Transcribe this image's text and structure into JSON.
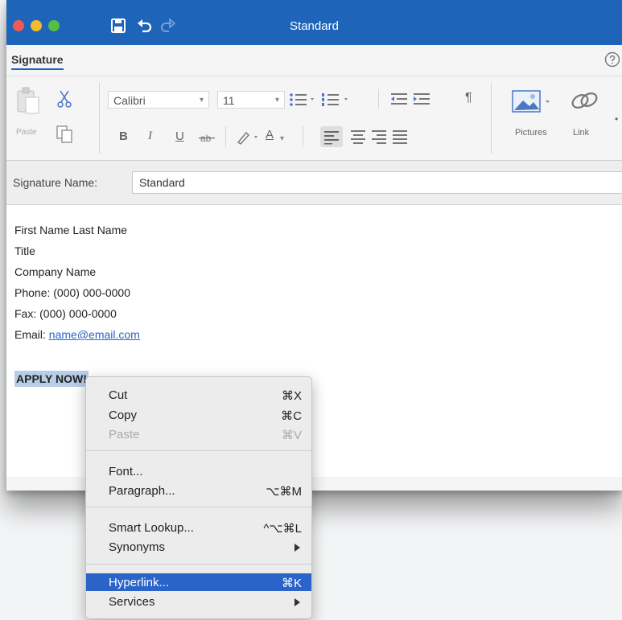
{
  "window": {
    "title": "Standard"
  },
  "tabs": {
    "signature": "Signature"
  },
  "ribbon": {
    "paste_label": "Paste",
    "font_name": "Calibri",
    "font_size": "11",
    "bold": "B",
    "italic": "I",
    "underline": "U",
    "font_color_letter": "A",
    "pilcrow": "¶",
    "pictures_label": "Pictures",
    "link_label": "Link"
  },
  "signature_name": {
    "label": "Signature Name:",
    "value": "Standard"
  },
  "signature_body": {
    "lines": [
      "First Name Last Name",
      "Title",
      "Company Name",
      "Phone: (000) 000-0000",
      "Fax: (000) 000-0000"
    ],
    "email_prefix": "Email: ",
    "email_link": "name@email.com",
    "apply_text": "APPLY NOW!"
  },
  "context_menu": {
    "cut": {
      "label": "Cut",
      "shortcut": "⌘X"
    },
    "copy": {
      "label": "Copy",
      "shortcut": "⌘C"
    },
    "paste": {
      "label": "Paste",
      "shortcut": "⌘V"
    },
    "font": {
      "label": "Font..."
    },
    "paragraph": {
      "label": "Paragraph...",
      "shortcut": "⌥⌘M"
    },
    "smart_lookup": {
      "label": "Smart Lookup...",
      "shortcut": "^⌥⌘L"
    },
    "synonyms": {
      "label": "Synonyms"
    },
    "hyperlink": {
      "label": "Hyperlink...",
      "shortcut": "⌘K"
    },
    "services": {
      "label": "Services"
    }
  },
  "colors": {
    "title_bar": "#1e65b9",
    "highlight": "#2b64c9",
    "link": "#2a62c8"
  }
}
